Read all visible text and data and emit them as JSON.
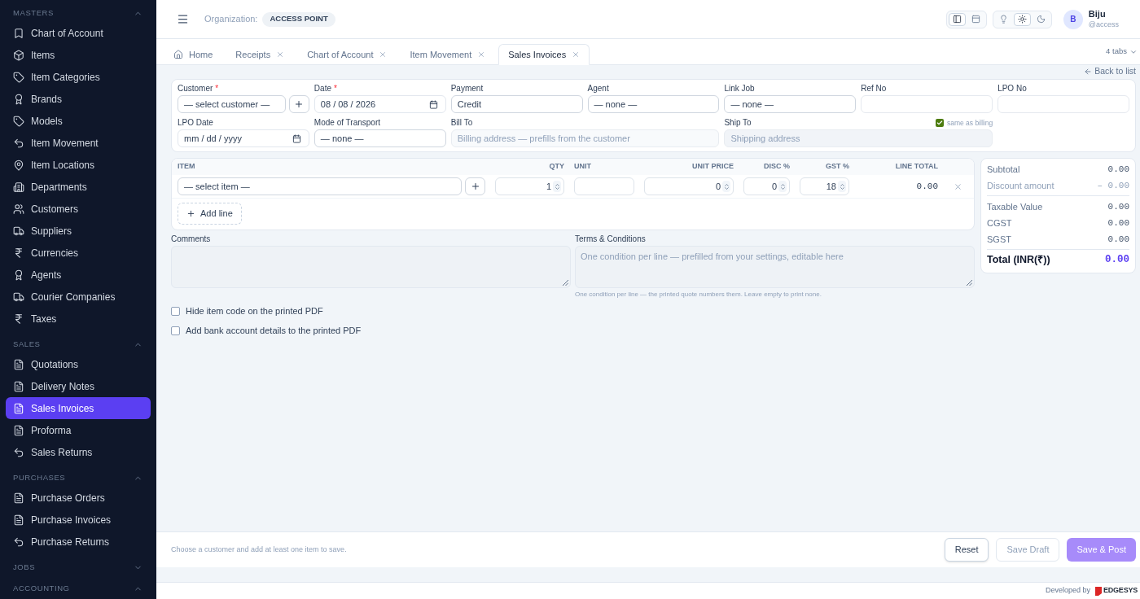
{
  "sidebar": {
    "sections": [
      {
        "title": "MASTERS",
        "expanded": true,
        "items": [
          {
            "label": "Chart of Account",
            "selected": false
          },
          {
            "label": "Items",
            "selected": false
          },
          {
            "label": "Item Categories",
            "selected": false
          },
          {
            "label": "Brands",
            "selected": false
          },
          {
            "label": "Models",
            "selected": false
          },
          {
            "label": "Item Movement",
            "selected": false
          },
          {
            "label": "Item Locations",
            "selected": false
          },
          {
            "label": "Departments",
            "selected": false
          },
          {
            "label": "Customers",
            "selected": false
          },
          {
            "label": "Suppliers",
            "selected": false
          },
          {
            "label": "Currencies",
            "selected": false
          },
          {
            "label": "Agents",
            "selected": false
          },
          {
            "label": "Courier Companies",
            "selected": false
          },
          {
            "label": "Taxes",
            "selected": false
          }
        ]
      },
      {
        "title": "SALES",
        "expanded": true,
        "items": [
          {
            "label": "Quotations",
            "selected": false
          },
          {
            "label": "Delivery Notes",
            "selected": false
          },
          {
            "label": "Sales Invoices",
            "selected": true
          },
          {
            "label": "Proforma",
            "selected": false
          },
          {
            "label": "Sales Returns",
            "selected": false
          }
        ]
      },
      {
        "title": "PURCHASES",
        "expanded": true,
        "items": [
          {
            "label": "Purchase Orders",
            "selected": false
          },
          {
            "label": "Purchase Invoices",
            "selected": false
          },
          {
            "label": "Purchase Returns",
            "selected": false
          }
        ]
      },
      {
        "title": "JOBS",
        "expanded": false
      },
      {
        "title": "ACCOUNTING",
        "expanded": true
      }
    ]
  },
  "header": {
    "organization_label": "Organization:",
    "organization": "ACCESS POINT",
    "view_modes": [
      {
        "selected": true
      },
      {
        "selected": false
      }
    ],
    "theme_modes": [
      {
        "selected": false
      },
      {
        "selected": true
      },
      {
        "selected": false
      }
    ],
    "user": {
      "initial": "B",
      "name": "Biju",
      "handle": "@access"
    }
  },
  "tabs": [
    {
      "kind": "home",
      "label": "Home",
      "selected": false
    },
    {
      "kind": "page",
      "label": "Receipts",
      "selected": false
    },
    {
      "kind": "page",
      "label": "Chart of Account",
      "selected": false
    },
    {
      "kind": "page",
      "label": "Item Movement",
      "selected": false
    },
    {
      "kind": "page",
      "label": "Sales Invoices",
      "selected": true
    }
  ],
  "tabs_menu": "4 tabs",
  "back_link": "Back to list",
  "form": {
    "fields": [
      {
        "kind": "select_add",
        "label": "Customer",
        "required_mark": "*",
        "value": "— select customer —"
      },
      {
        "kind": "date",
        "label": "Date",
        "required_mark": "*",
        "value": "08 / 08 / 2026"
      },
      {
        "kind": "text",
        "label": "Payment",
        "value": "Credit"
      },
      {
        "kind": "select",
        "label": "Agent",
        "value": "— none —"
      },
      {
        "kind": "select",
        "label": "Link Job",
        "value": "— none —"
      },
      {
        "kind": "text",
        "label": "Ref No"
      },
      {
        "kind": "text",
        "label": "LPO No"
      },
      {
        "kind": "date",
        "label": "LPO Date",
        "placeholder": "mm / dd / yyyy"
      },
      {
        "kind": "select",
        "label": "Mode of Transport",
        "value": "— none —"
      },
      {
        "kind": "address",
        "label": "Bill To",
        "placeholder": "Billing address — prefills from the customer"
      },
      {
        "kind": "address",
        "label": "Ship To",
        "placeholder": "Shipping address",
        "same_as_billing": {
          "label": "same as billing",
          "checked": true
        }
      }
    ]
  },
  "line_items": {
    "columns": [
      "ITEM",
      "QTY",
      "UNIT",
      "UNIT PRICE",
      "DISC %",
      "GST %",
      "LINE TOTAL"
    ],
    "rows": [
      {
        "item": "— select item —",
        "qty": "1",
        "unit_price": "0",
        "disc": "0",
        "gst": "18",
        "line_total": "0.00"
      }
    ],
    "add_line": "Add line"
  },
  "totals": {
    "groups": [
      [
        {
          "label": "Subtotal",
          "value": "0.00",
          "muted": false
        },
        {
          "label": "Discount amount",
          "value": "– 0.00",
          "muted": true
        }
      ],
      [
        {
          "label": "Taxable Value",
          "value": "0.00",
          "muted": false
        },
        {
          "label": "CGST",
          "value": "0.00",
          "muted": false
        },
        {
          "label": "SGST",
          "value": "0.00",
          "muted": false
        }
      ]
    ],
    "total": {
      "label": "Total (INR(₹))",
      "value": "0.00"
    }
  },
  "comments": {
    "label": "Comments"
  },
  "terms": {
    "label": "Terms & Conditions",
    "placeholder": "One condition per line — prefilled from your settings, editable here",
    "hint": "One condition per line — the printed quote numbers them. Leave empty to print none."
  },
  "options": [
    {
      "label": "Hide item code on the printed PDF",
      "checked": false
    },
    {
      "label": "Add bank account details to the printed PDF",
      "checked": false
    }
  ],
  "footer": {
    "message": "Choose a customer and add at least one item to save.",
    "buttons": [
      {
        "kind": "secondary",
        "label": "Reset",
        "disabled": false
      },
      {
        "kind": "secondary",
        "label": "Save Draft",
        "disabled": true
      },
      {
        "kind": "primary",
        "label": "Save & Post",
        "disabled": true
      }
    ]
  },
  "credit": {
    "label": "Developed by",
    "brand": "EDGESYS"
  }
}
